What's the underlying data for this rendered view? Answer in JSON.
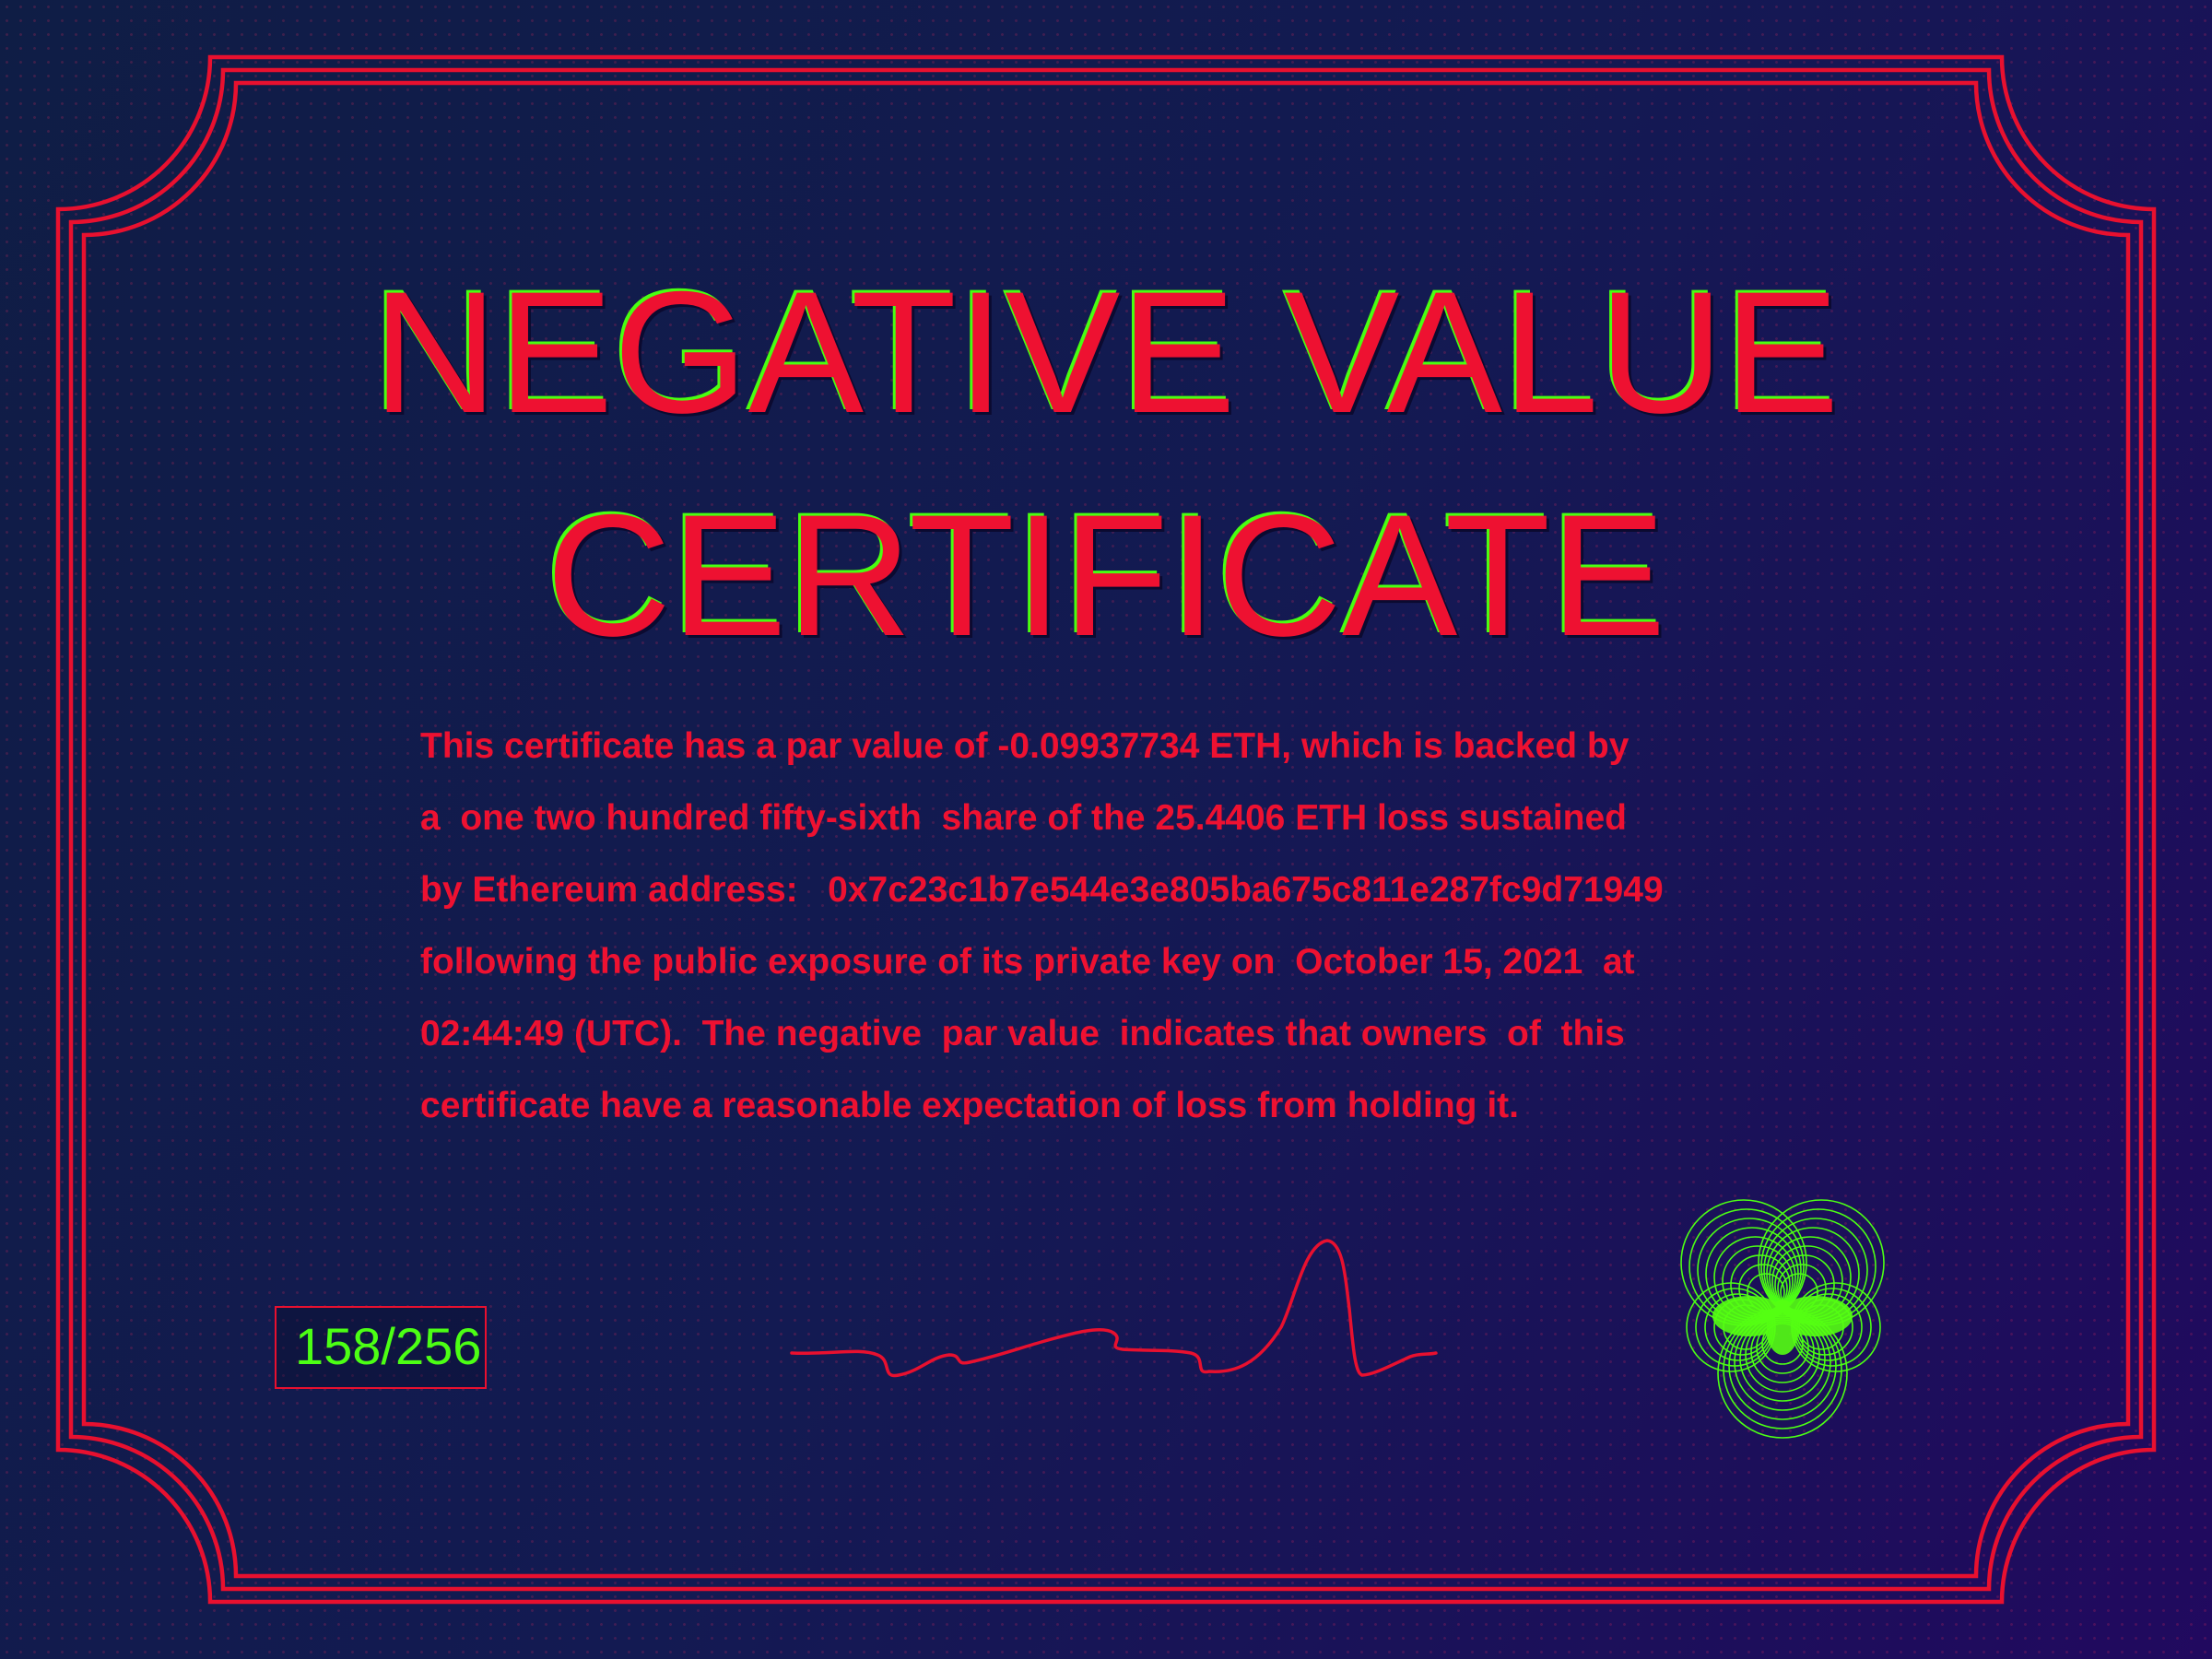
{
  "certificate": {
    "title_line_1": "NEGATIVE VALUE",
    "title_line_2": "CERTIFICATE",
    "body_lines": [
      "This certificate has a par value of -0.09937734 ETH, which is backed by",
      "a  one two hundred fifty-sixth  share of the 25.4406 ETH loss sustained",
      "by Ethereum address:   0x7c23c1b7e544e3e805ba675c811e287fc9d71949",
      "following the public exposure of its private key on  October 15, 2021  at",
      "02:44:49 (UTC).  The negative  par value  indicates that owners  of  this",
      "certificate have a reasonable expectation of loss from holding it."
    ],
    "serial_number": "158/256"
  },
  "colors": {
    "background": "#131a52",
    "accent_red": "#ee1131",
    "accent_green": "#4cff14"
  }
}
